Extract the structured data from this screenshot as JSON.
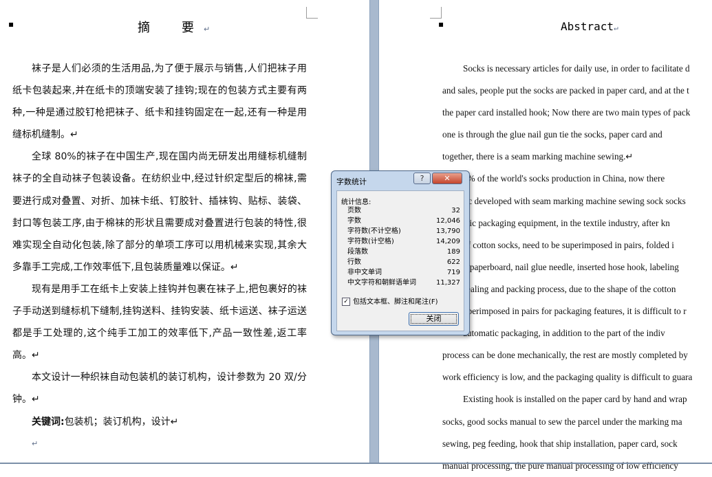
{
  "left_page": {
    "title": "摘　要",
    "mark": "↵",
    "paragraphs": [
      "袜子是人们必须的生活用品,为了便于展示与销售,人们把袜子用纸卡包装起来,并在纸卡的顶端安装了挂钩;现在的包装方式主要有两种,一种是通过胶钉枪把袜子、纸卡和挂钩固定在一起,还有一种是用缝标机缝制。↵",
      "全球 80%的袜子在中国生产,现在国内尚无研发出用缝标机缝制袜子的全自动袜子包装设备。在纺织业中,经过针织定型后的棉袜,需要进行成对叠置、对折、加袜卡纸、钉胶针、插袜钩、贴标、装袋、封口等包装工序,由于棉袜的形状且需要成对叠置进行包装的特性,很难实现全自动化包装,除了部分的单项工序可以用机械来实现,其余大多靠手工完成,工作效率低下,且包装质量难以保证。↵",
      "现有是用手工在纸卡上安装上挂钩并包裹在袜子上,把包裹好的袜子手动送到缝标机下缝制,挂钩送料、挂钩安装、纸卡运送、袜子运送都是手工处理的,这个纯手工加工的效率低下,产品一致性差,返工率高。↵",
      "本文设计一种织袜自动包装机的装订机构，设计参数为 20 双/分钟。↵"
    ],
    "keywords_label": "关键词:",
    "keywords": "包装机；装订机构，设计↵",
    "empty_lines": [
      "↵",
      "↵"
    ]
  },
  "right_page": {
    "title": "Abstract",
    "mark": "↵",
    "lines": [
      "Socks is necessary articles for daily use, in order to facilitate d",
      "and sales, people put the socks are packed in paper card, and at the t",
      "the paper card installed hook; Now there are two main types of pack",
      "one is through the glue nail gun tie the socks, paper card and ",
      "together, there is a seam marking machine sewing.↵",
      "0% of the world's socks production in China, now there ",
      "tic developed with seam marking machine sewing sock socks",
      "atic packaging equipment, in the textile industry, after kn",
      "of cotton socks, need to be superimposed in pairs, folded i",
      "k paperboard, nail glue needle, inserted hose hook, labeling",
      "sealing and packing process, due to the shape of the cotton ",
      "uperimposed in pairs for packaging features, it is difficult to r",
      "automatic packaging, in addition to the part of the indiv",
      "process can be done mechanically, the rest are mostly completed by",
      "work efficiency is low, and the packaging quality is difficult to guara",
      "Existing hook is installed on the paper card by hand and wrap",
      "socks, good socks manual to sew the parcel under the marking ma",
      "sewing, peg feeding, hook that ship installation, paper card, sock",
      "manual processing, the pure manual processing of low efficiency"
    ]
  },
  "dialog": {
    "title": "字数统计",
    "help": "?",
    "close_x": "✕",
    "stats_label": "统计信息:",
    "stats": [
      {
        "label": "页数",
        "value": "32"
      },
      {
        "label": "字数",
        "value": "12,046"
      },
      {
        "label": "字符数(不计空格)",
        "value": "13,790"
      },
      {
        "label": "字符数(计空格)",
        "value": "14,209"
      },
      {
        "label": "段落数",
        "value": "189"
      },
      {
        "label": "行数",
        "value": "622"
      },
      {
        "label": "非中文单词",
        "value": "719"
      },
      {
        "label": "中文字符和朝鲜语单词",
        "value": "11,327"
      }
    ],
    "checkbox_label": "包括文本框、脚注和尾注(F)",
    "checkbox_checked": true,
    "close_button": "关闭"
  }
}
